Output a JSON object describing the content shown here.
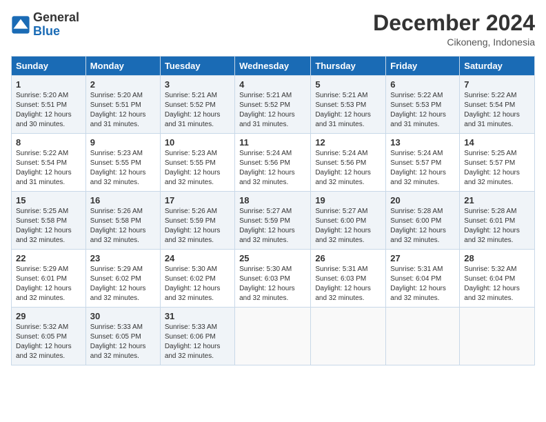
{
  "logo": {
    "general": "General",
    "blue": "Blue"
  },
  "header": {
    "month": "December 2024",
    "location": "Cikoneng, Indonesia"
  },
  "weekdays": [
    "Sunday",
    "Monday",
    "Tuesday",
    "Wednesday",
    "Thursday",
    "Friday",
    "Saturday"
  ],
  "weeks": [
    [
      {
        "day": 1,
        "sunrise": "5:20 AM",
        "sunset": "5:51 PM",
        "daylight": "12 hours and 30 minutes."
      },
      {
        "day": 2,
        "sunrise": "5:20 AM",
        "sunset": "5:51 PM",
        "daylight": "12 hours and 31 minutes."
      },
      {
        "day": 3,
        "sunrise": "5:21 AM",
        "sunset": "5:52 PM",
        "daylight": "12 hours and 31 minutes."
      },
      {
        "day": 4,
        "sunrise": "5:21 AM",
        "sunset": "5:52 PM",
        "daylight": "12 hours and 31 minutes."
      },
      {
        "day": 5,
        "sunrise": "5:21 AM",
        "sunset": "5:53 PM",
        "daylight": "12 hours and 31 minutes."
      },
      {
        "day": 6,
        "sunrise": "5:22 AM",
        "sunset": "5:53 PM",
        "daylight": "12 hours and 31 minutes."
      },
      {
        "day": 7,
        "sunrise": "5:22 AM",
        "sunset": "5:54 PM",
        "daylight": "12 hours and 31 minutes."
      }
    ],
    [
      {
        "day": 8,
        "sunrise": "5:22 AM",
        "sunset": "5:54 PM",
        "daylight": "12 hours and 31 minutes."
      },
      {
        "day": 9,
        "sunrise": "5:23 AM",
        "sunset": "5:55 PM",
        "daylight": "12 hours and 32 minutes."
      },
      {
        "day": 10,
        "sunrise": "5:23 AM",
        "sunset": "5:55 PM",
        "daylight": "12 hours and 32 minutes."
      },
      {
        "day": 11,
        "sunrise": "5:24 AM",
        "sunset": "5:56 PM",
        "daylight": "12 hours and 32 minutes."
      },
      {
        "day": 12,
        "sunrise": "5:24 AM",
        "sunset": "5:56 PM",
        "daylight": "12 hours and 32 minutes."
      },
      {
        "day": 13,
        "sunrise": "5:24 AM",
        "sunset": "5:57 PM",
        "daylight": "12 hours and 32 minutes."
      },
      {
        "day": 14,
        "sunrise": "5:25 AM",
        "sunset": "5:57 PM",
        "daylight": "12 hours and 32 minutes."
      }
    ],
    [
      {
        "day": 15,
        "sunrise": "5:25 AM",
        "sunset": "5:58 PM",
        "daylight": "12 hours and 32 minutes."
      },
      {
        "day": 16,
        "sunrise": "5:26 AM",
        "sunset": "5:58 PM",
        "daylight": "12 hours and 32 minutes."
      },
      {
        "day": 17,
        "sunrise": "5:26 AM",
        "sunset": "5:59 PM",
        "daylight": "12 hours and 32 minutes."
      },
      {
        "day": 18,
        "sunrise": "5:27 AM",
        "sunset": "5:59 PM",
        "daylight": "12 hours and 32 minutes."
      },
      {
        "day": 19,
        "sunrise": "5:27 AM",
        "sunset": "6:00 PM",
        "daylight": "12 hours and 32 minutes."
      },
      {
        "day": 20,
        "sunrise": "5:28 AM",
        "sunset": "6:00 PM",
        "daylight": "12 hours and 32 minutes."
      },
      {
        "day": 21,
        "sunrise": "5:28 AM",
        "sunset": "6:01 PM",
        "daylight": "12 hours and 32 minutes."
      }
    ],
    [
      {
        "day": 22,
        "sunrise": "5:29 AM",
        "sunset": "6:01 PM",
        "daylight": "12 hours and 32 minutes."
      },
      {
        "day": 23,
        "sunrise": "5:29 AM",
        "sunset": "6:02 PM",
        "daylight": "12 hours and 32 minutes."
      },
      {
        "day": 24,
        "sunrise": "5:30 AM",
        "sunset": "6:02 PM",
        "daylight": "12 hours and 32 minutes."
      },
      {
        "day": 25,
        "sunrise": "5:30 AM",
        "sunset": "6:03 PM",
        "daylight": "12 hours and 32 minutes."
      },
      {
        "day": 26,
        "sunrise": "5:31 AM",
        "sunset": "6:03 PM",
        "daylight": "12 hours and 32 minutes."
      },
      {
        "day": 27,
        "sunrise": "5:31 AM",
        "sunset": "6:04 PM",
        "daylight": "12 hours and 32 minutes."
      },
      {
        "day": 28,
        "sunrise": "5:32 AM",
        "sunset": "6:04 PM",
        "daylight": "12 hours and 32 minutes."
      }
    ],
    [
      {
        "day": 29,
        "sunrise": "5:32 AM",
        "sunset": "6:05 PM",
        "daylight": "12 hours and 32 minutes."
      },
      {
        "day": 30,
        "sunrise": "5:33 AM",
        "sunset": "6:05 PM",
        "daylight": "12 hours and 32 minutes."
      },
      {
        "day": 31,
        "sunrise": "5:33 AM",
        "sunset": "6:06 PM",
        "daylight": "12 hours and 32 minutes."
      },
      null,
      null,
      null,
      null
    ]
  ]
}
